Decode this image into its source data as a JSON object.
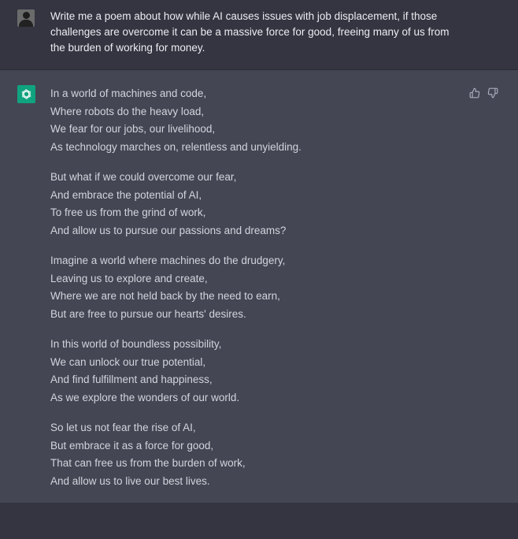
{
  "user_message": {
    "avatar": "user-avatar",
    "text": "Write me a poem about how while AI causes issues with job displacement, if those challenges are overcome it can be a massive force for good, freeing many of us from the burden of working for money."
  },
  "assistant_message": {
    "avatar": "openai-logo-icon",
    "feedback": {
      "up": "thumbs-up-icon",
      "down": "thumbs-down-icon"
    },
    "stanzas": [
      [
        "In a world of machines and code,",
        "Where robots do the heavy load,",
        "We fear for our jobs, our livelihood,",
        "As technology marches on, relentless and unyielding."
      ],
      [
        "But what if we could overcome our fear,",
        "And embrace the potential of AI,",
        "To free us from the grind of work,",
        "And allow us to pursue our passions and dreams?"
      ],
      [
        "Imagine a world where machines do the drudgery,",
        "Leaving us to explore and create,",
        "Where we are not held back by the need to earn,",
        "But are free to pursue our hearts' desires."
      ],
      [
        "In this world of boundless possibility,",
        "We can unlock our true potential,",
        "And find fulfillment and happiness,",
        "As we explore the wonders of our world."
      ],
      [
        "So let us not fear the rise of AI,",
        "But embrace it as a force for good,",
        "That can free us from the burden of work,",
        "And allow us to live our best lives."
      ]
    ]
  },
  "colors": {
    "user_bg": "#343541",
    "assistant_bg": "#444654",
    "accent": "#10a37f",
    "text": "#d1d5db"
  }
}
